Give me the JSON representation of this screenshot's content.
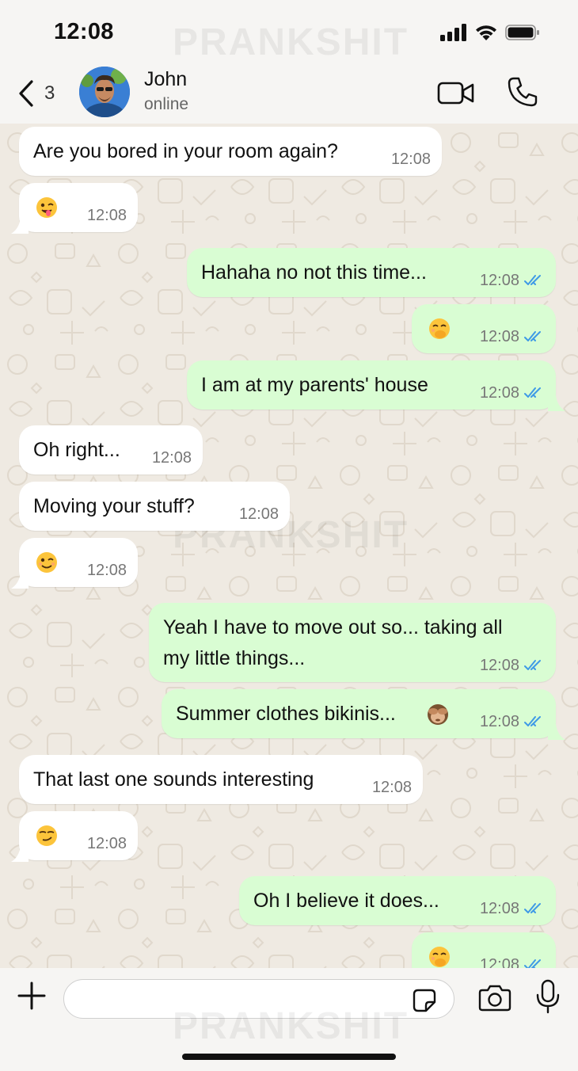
{
  "status_bar": {
    "time": "12:08"
  },
  "watermark": "PRANKSHIT",
  "header": {
    "back_count": "3",
    "contact_name": "John",
    "contact_status": "online"
  },
  "icons": {
    "back": "chevron-left-icon",
    "video": "video-camera-icon",
    "call": "phone-icon",
    "plus": "plus-icon",
    "sticker": "sticker-icon",
    "camera": "camera-icon",
    "mic": "microphone-icon",
    "read": "double-check-icon"
  },
  "colors": {
    "incoming_bubble": "#ffffff",
    "outgoing_bubble": "#d9fdd3",
    "read_ticks": "#3f9ae6",
    "wallpaper": "#efeae2"
  },
  "messages": [
    {
      "dir": "in",
      "text": "Are you bored in your room again?",
      "time": "12:08"
    },
    {
      "dir": "in",
      "emoji": "winking-face-with-tongue",
      "time": "12:08"
    },
    {
      "dir": "out",
      "text": "Hahaha no not this time...",
      "time": "12:08",
      "status": "read"
    },
    {
      "dir": "out",
      "emoji": "face-with-hand-over-mouth",
      "time": "12:08",
      "status": "read"
    },
    {
      "dir": "out",
      "text": "I am at my parents' house",
      "time": "12:08",
      "status": "read"
    },
    {
      "dir": "in",
      "text": "Oh right...",
      "time": "12:08"
    },
    {
      "dir": "in",
      "text": "Moving your stuff?",
      "time": "12:08"
    },
    {
      "dir": "in",
      "emoji": "winking-face",
      "time": "12:08"
    },
    {
      "dir": "out",
      "lines": [
        "Yeah I have to move out so... taking all",
        "my little things..."
      ],
      "time": "12:08",
      "status": "read"
    },
    {
      "dir": "out",
      "text": "Summer clothes bikinis...",
      "emoji": "see-no-evil-monkey",
      "time": "12:08",
      "status": "read"
    },
    {
      "dir": "in",
      "text": "That last one sounds interesting",
      "time": "12:08"
    },
    {
      "dir": "in",
      "emoji": "smirking-face",
      "time": "12:08"
    },
    {
      "dir": "out",
      "text": "Oh I believe it does...",
      "time": "12:08",
      "status": "read"
    },
    {
      "dir": "out",
      "emoji": "face-with-hand-over-mouth",
      "time": "12:08",
      "status": "read"
    }
  ],
  "input": {
    "placeholder": "",
    "value": ""
  }
}
